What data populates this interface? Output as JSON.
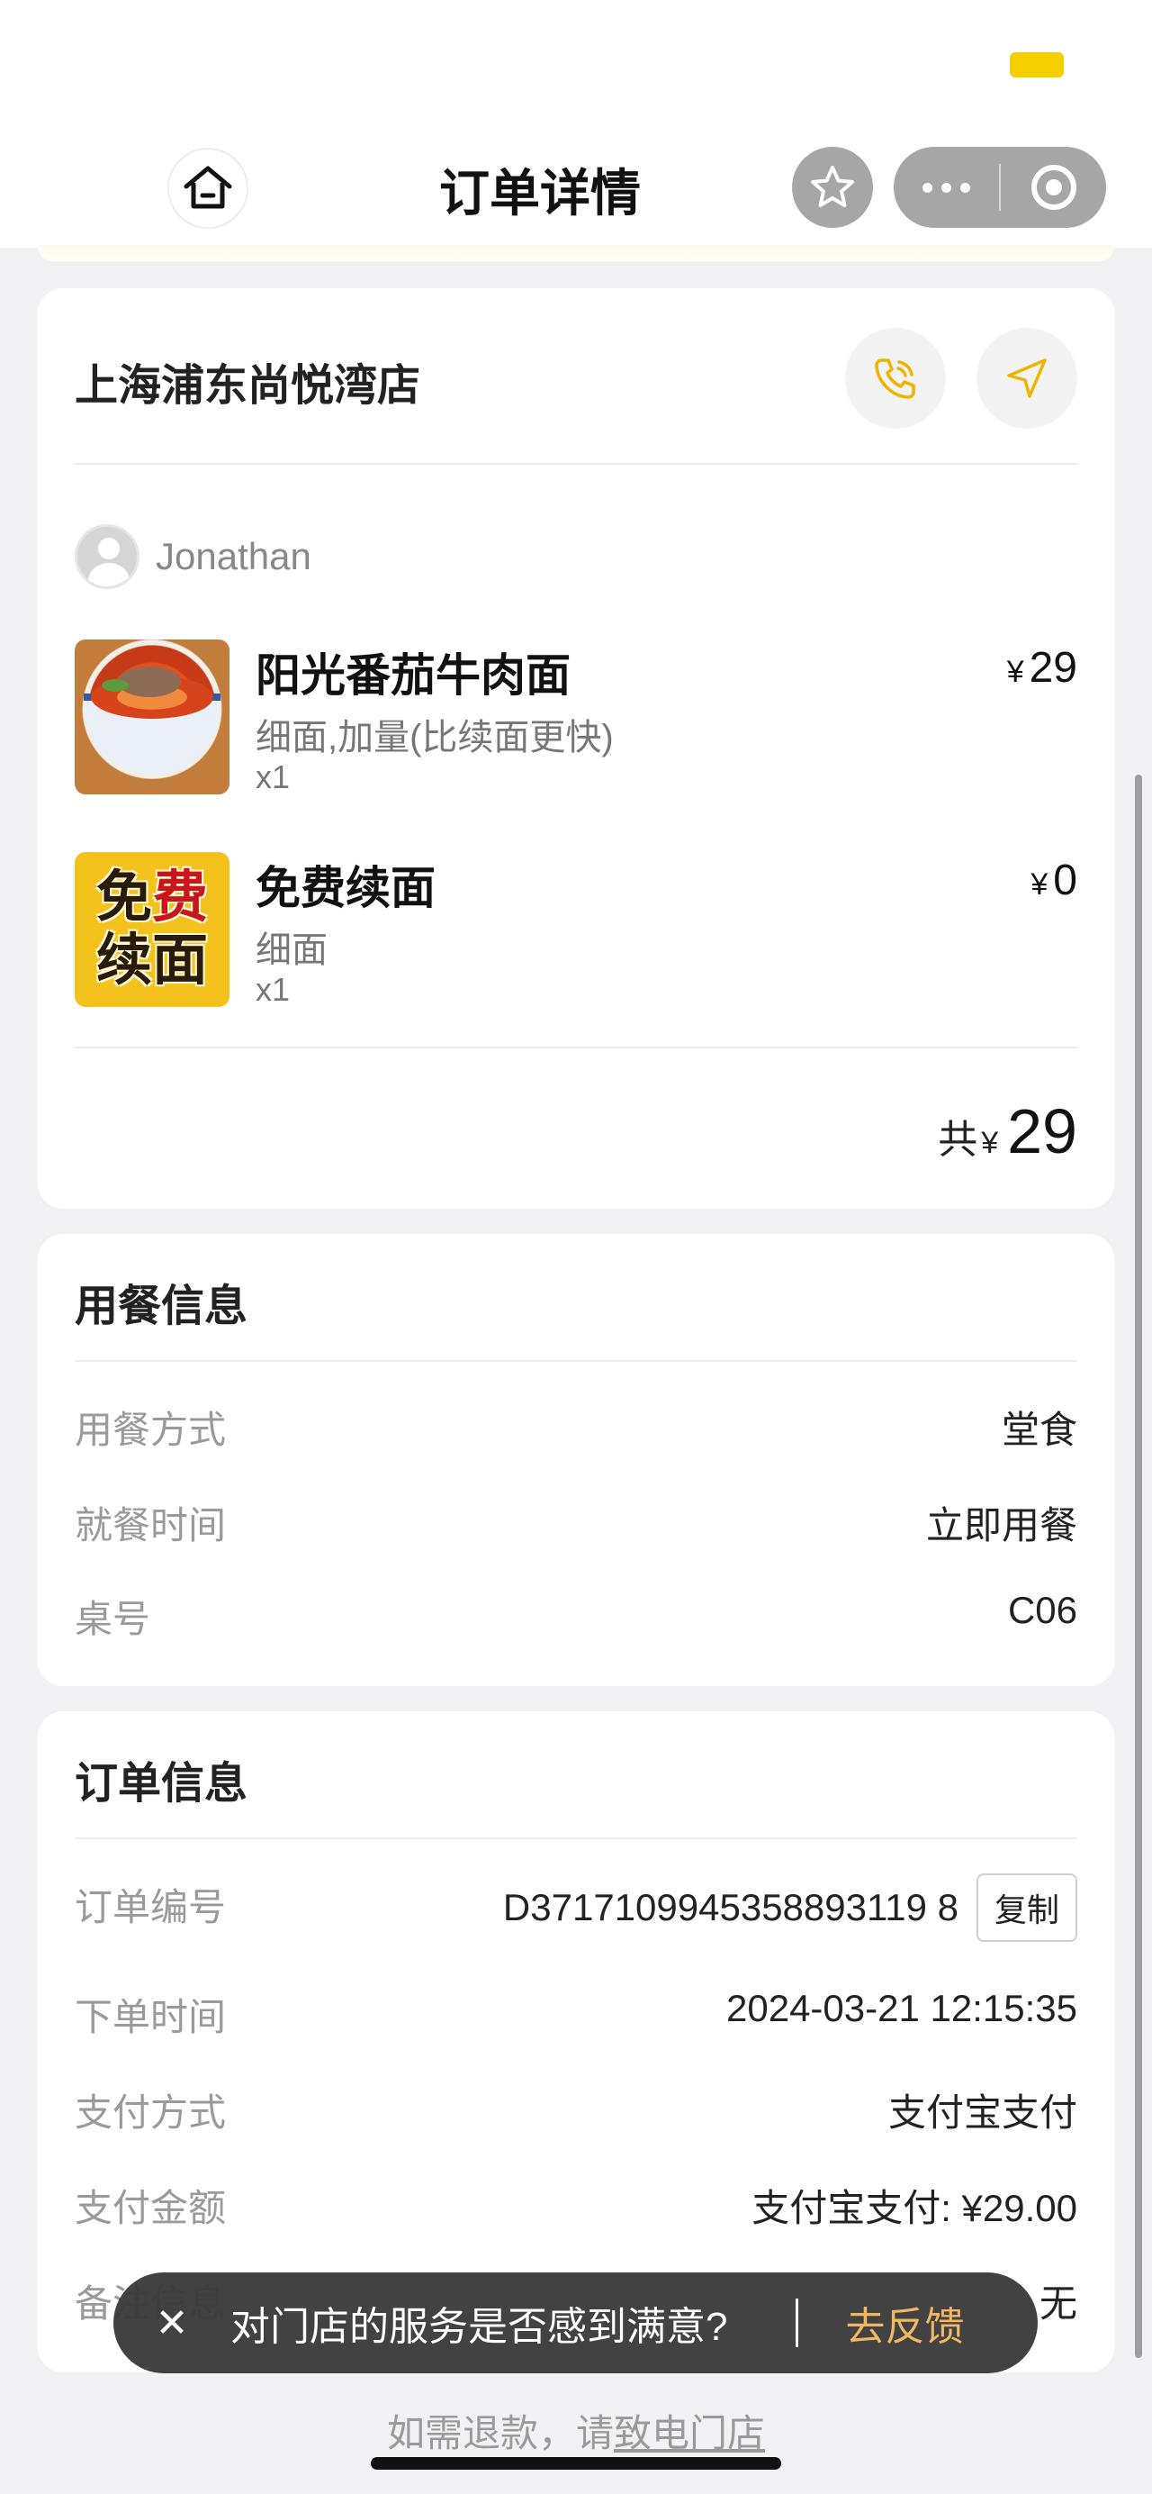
{
  "header": {
    "title": "订单详情",
    "home_icon": "home-icon",
    "favorite_icon": "star-icon",
    "more_icon": "more-icon",
    "close_icon": "target-icon"
  },
  "store": {
    "name": "上海浦东尚悦湾店",
    "call_icon": "phone-icon",
    "navigate_icon": "navigation-icon"
  },
  "customer": {
    "name": "Jonathan"
  },
  "items": [
    {
      "name": "阳光番茄牛肉面",
      "spec": "细面,加量(比续面更快)",
      "qty": "x1",
      "currency": "¥",
      "price": "29"
    },
    {
      "name": "免费续面",
      "spec": "细面",
      "qty": "x1",
      "currency": "¥",
      "price": "0",
      "thumb_text": [
        "免",
        "费",
        "续",
        "面"
      ]
    }
  ],
  "total": {
    "label": "共",
    "currency": "¥",
    "amount": "29"
  },
  "dining": {
    "title": "用餐信息",
    "rows": [
      {
        "key": "用餐方式",
        "value": "堂食"
      },
      {
        "key": "就餐时间",
        "value": "立即用餐"
      },
      {
        "key": "桌号",
        "value": "C06"
      }
    ]
  },
  "order": {
    "title": "订单信息",
    "rows": [
      {
        "key": "订单编号",
        "value": "D3717109945358893119 8",
        "copy_label": "复制"
      },
      {
        "key": "下单时间",
        "value": "2024-03-21 12:15:35"
      },
      {
        "key": "支付方式",
        "value": "支付宝支付"
      },
      {
        "key": "支付金额",
        "value": "支付宝支付: ¥29.00"
      },
      {
        "key": "备注信息",
        "value": "无"
      }
    ]
  },
  "toast": {
    "close": "✕",
    "message": "对门店的服务是否感到满意?",
    "action": "去反馈"
  },
  "footer": {
    "prefix": "如需退款，请",
    "link": "致电门店"
  },
  "colors": {
    "accent": "#f5cf00",
    "icon_accent": "#f0b400",
    "feedback": "#f0b765"
  }
}
